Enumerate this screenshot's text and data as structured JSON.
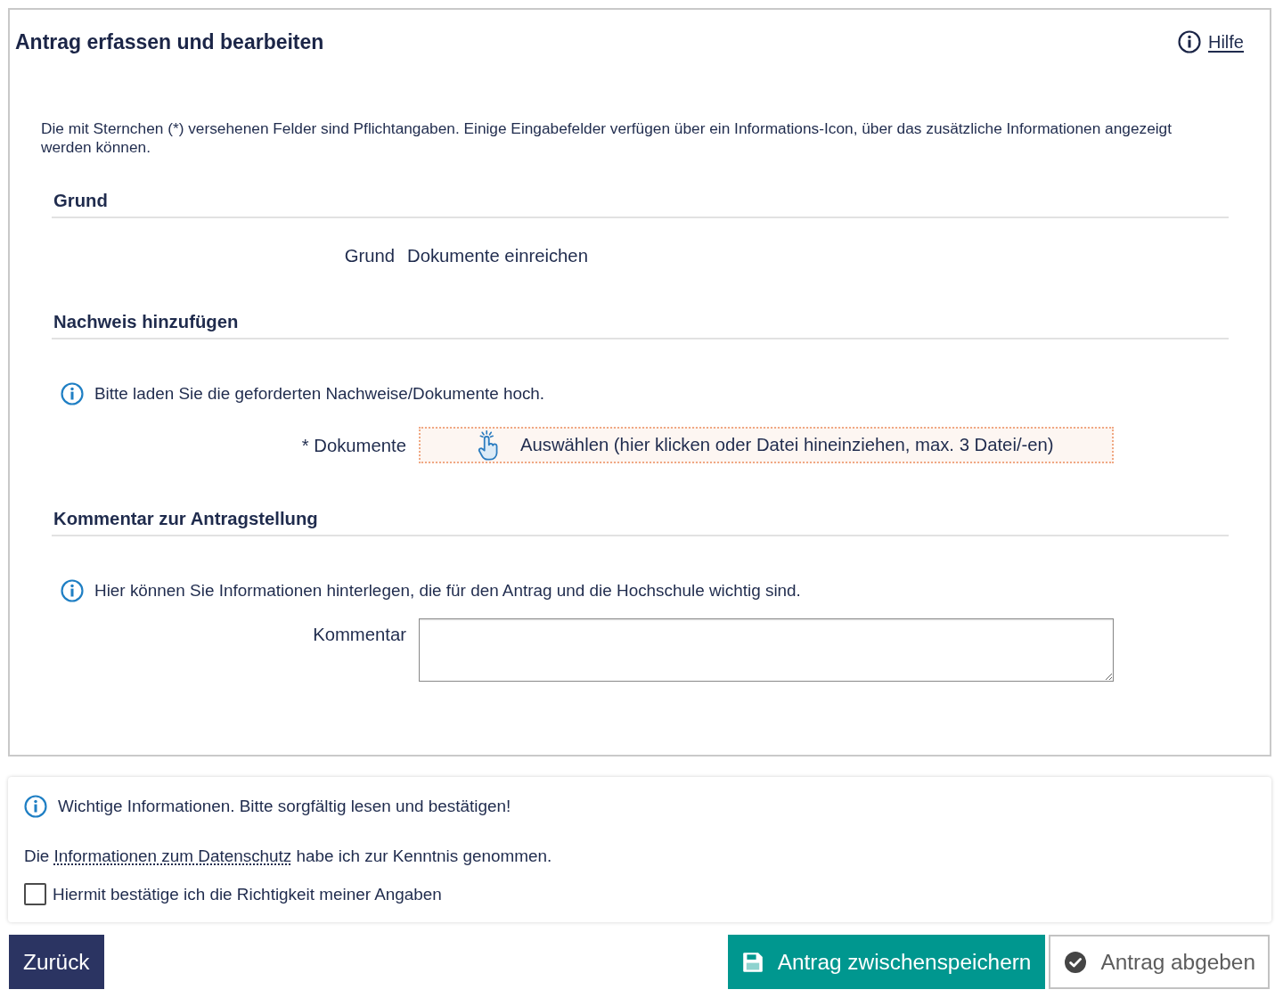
{
  "header": {
    "title": "Antrag erfassen und bearbeiten",
    "help_link": "Hilfe"
  },
  "intro": "Die mit Sternchen (*) versehenen Felder sind Pflichtangaben. Einige Eingabefelder verfügen über ein Informations-Icon, über das zusätzliche Informationen angezeigt werden können.",
  "sections": [
    {
      "heading": "Grund",
      "fields": [
        {
          "kind": "readonly",
          "label": "Grund",
          "value": "Dokumente einreichen"
        }
      ]
    },
    {
      "heading": "Nachweis hinzufügen",
      "info": "Bitte laden Sie die geforderten Nachweise/Dokumente hoch.",
      "fields": [
        {
          "kind": "upload",
          "label": "* Dokumente",
          "prompt": "Auswählen (hier klicken oder Datei hineinziehen, max. 3 Datei/-en)"
        }
      ]
    },
    {
      "heading": "Kommentar zur Antragstellung",
      "info": "Hier können Sie Informationen hinterlegen, die für den Antrag und die Hochschule wichtig sind.",
      "fields": [
        {
          "kind": "textarea",
          "label": "Kommentar"
        }
      ]
    }
  ],
  "confirmation": {
    "info": "Wichtige Informationen. Bitte sorgfältig lesen und bestätigen!",
    "privacy_before": "Die",
    "privacy_link": "Informationen zum Datenschutz",
    "privacy_after": "habe ich zur Kenntnis genommen.",
    "checkbox": {
      "label": "Hiermit bestätige ich die Richtigkeit meiner Angaben",
      "checked": false
    }
  },
  "buttons": [
    {
      "kind": "back",
      "label": "Zurück"
    },
    {
      "kind": "save",
      "label": "Antrag zwischenspeichern"
    },
    {
      "kind": "submit",
      "label": "Antrag abgeben"
    }
  ]
}
